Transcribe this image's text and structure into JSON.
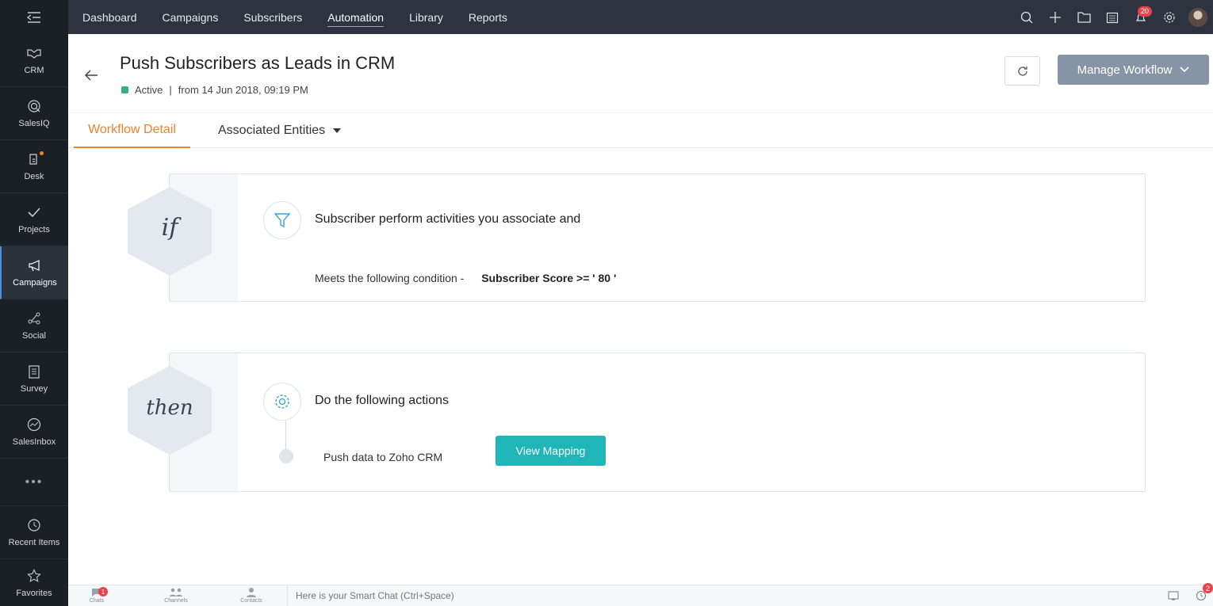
{
  "rail": {
    "items": [
      {
        "label": "CRM"
      },
      {
        "label": "SalesIQ"
      },
      {
        "label": "Desk"
      },
      {
        "label": "Projects"
      },
      {
        "label": "Campaigns"
      },
      {
        "label": "Social"
      },
      {
        "label": "Survey"
      },
      {
        "label": "SalesInbox"
      }
    ],
    "more": "•••",
    "recent": "Recent Items",
    "favorites": "Favorites"
  },
  "nav": {
    "tabs": [
      "Dashboard",
      "Campaigns",
      "Subscribers",
      "Automation",
      "Library",
      "Reports"
    ],
    "active_tab": "Automation",
    "notifications_count": "20"
  },
  "header": {
    "title": "Push Subscribers as Leads in CRM",
    "status": "Active",
    "status_sep": "|",
    "from_text": "from  14 Jun 2018, 09:19 PM",
    "manage_label": "Manage Workflow"
  },
  "tabs": {
    "detail": "Workflow Detail",
    "entities": "Associated Entities"
  },
  "if_card": {
    "hex_label": "if",
    "heading": "Subscriber perform activities you associate and",
    "condition_prefix": "Meets the following condition -",
    "condition_value": "Subscriber Score >= ' 80 '"
  },
  "then_card": {
    "hex_label": "then",
    "heading": "Do the following actions",
    "action": "Push data to Zoho CRM",
    "button": "View Mapping"
  },
  "bottom": {
    "chats": "Chats",
    "chats_badge": "1",
    "channels": "Channels",
    "contacts": "Contacts",
    "placeholder": "Here is your Smart Chat (Ctrl+Space)",
    "reminder_badge": "2"
  },
  "colors": {
    "accent": "#f0812e",
    "active_status": "#2fb57a",
    "teal_button": "#1fb6b8",
    "manage_button": "#8694a6",
    "nav_bg": "#2d3440",
    "rail_bg": "#1b1f26"
  }
}
